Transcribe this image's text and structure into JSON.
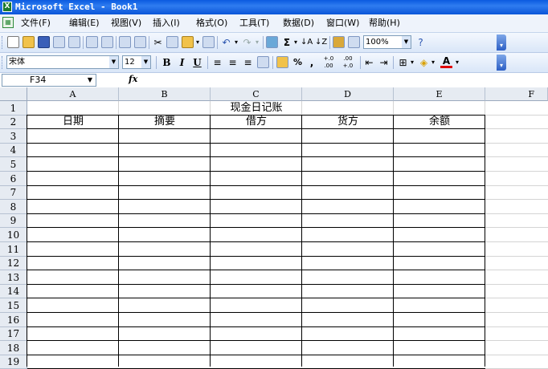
{
  "window": {
    "title": "Microsoft Excel - Book1"
  },
  "menu": [
    "文件(F)",
    "编辑(E)",
    "视图(V)",
    "插入(I)",
    "格式(O)",
    "工具(T)",
    "数据(D)",
    "窗口(W)",
    "帮助(H)"
  ],
  "toolbar": {
    "zoom": "100%",
    "font_name": "宋体",
    "font_size": "12",
    "bold": "B",
    "italic": "I",
    "underline": "U",
    "sum": "Σ",
    "percent": "%",
    "comma": ",",
    "inc_decimal": "+.0 .00",
    "dec_decimal": ".00 +.0"
  },
  "formula_bar": {
    "name_box": "F34",
    "fx": "fx",
    "content": ""
  },
  "sheet": {
    "columns": [
      "A",
      "B",
      "C",
      "D",
      "E",
      "F"
    ],
    "rows": [
      "1",
      "2",
      "3",
      "4",
      "5",
      "6",
      "7",
      "8",
      "9",
      "10",
      "11",
      "12",
      "13",
      "14",
      "15",
      "16",
      "17",
      "18",
      "19"
    ],
    "title": "现金日记账",
    "headers": [
      "日期",
      "摘要",
      "借方",
      "货方",
      "余额"
    ]
  },
  "colors": {
    "title_bar": "#0a5ae0",
    "header_bg": "#e6ebf2",
    "toolbar_bg": "#d9e6f8"
  }
}
